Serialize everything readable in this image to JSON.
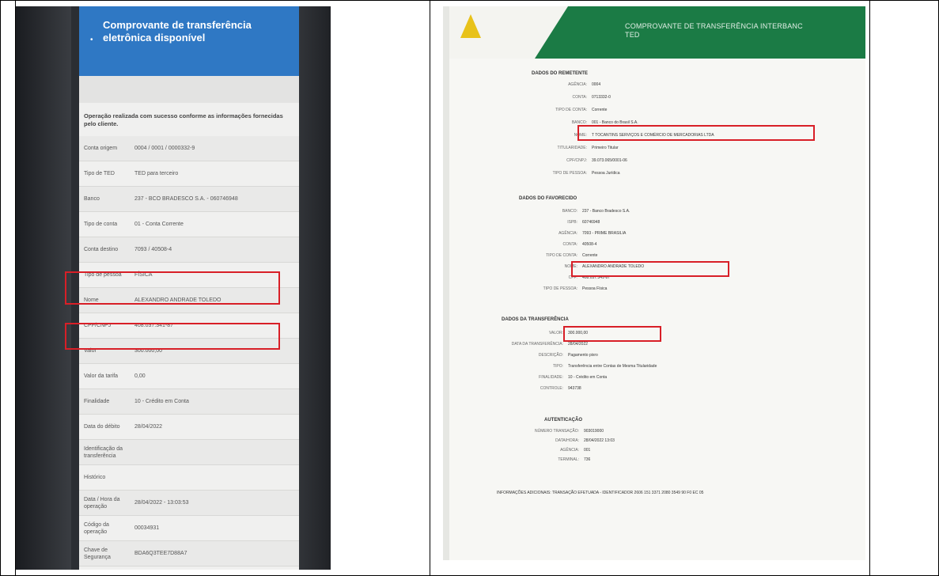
{
  "phone": {
    "header_title": "Comprovante de transferência eletrônica disponível",
    "notice": "Operação realizada com sucesso conforme as informações fornecidas pelo cliente.",
    "rows": [
      {
        "label": "Conta origem",
        "value": "0004 / 0001 / 0000332-9"
      },
      {
        "label": "Tipo de TED",
        "value": "TED para terceiro"
      },
      {
        "label": "Banco",
        "value": "237 - BCO BRADESCO S.A. - 060746948"
      },
      {
        "label": "Tipo de conta",
        "value": "01 - Conta Corrente"
      },
      {
        "label": "Conta destino",
        "value": "7093 / 40508-4"
      },
      {
        "label": "Tipo de pessoa",
        "value": "FÍSICA"
      },
      {
        "label": "Nome",
        "value": "ALEXANDRO ANDRADE TOLEDO"
      },
      {
        "label": "CPF/CNPJ",
        "value": "408.037.341-87"
      },
      {
        "label": "Valor",
        "value": "300.000,00"
      },
      {
        "label": "Valor da tarifa",
        "value": "0,00"
      },
      {
        "label": "Finalidade",
        "value": "10 - Crédito em Conta"
      },
      {
        "label": "Data do débito",
        "value": "28/04/2022"
      },
      {
        "label": "Identificação da transferência",
        "value": ""
      },
      {
        "label": "Histórico",
        "value": ""
      },
      {
        "label": "Data / Hora da operação",
        "value": "28/04/2022 - 13:03:53"
      },
      {
        "label": "Código da operação",
        "value": "00034931"
      },
      {
        "label": "Chave de Segurança",
        "value": "BDA6Q3TEE7D88A7"
      }
    ]
  },
  "receipt": {
    "banner_title": "COMPROVANTE DE TRANSFERÊNCIA INTERBANC",
    "banner_subtitle": "TED",
    "logo_caption": "",
    "sections": {
      "remetente": "DADOS DO REMETENTE",
      "favorecido": "DADOS DO FAVORECIDO",
      "transferencia": "DADOS DA TRANSFERÊNCIA",
      "autenticacao": "AUTENTICAÇÃO"
    },
    "remetente_rows": [
      {
        "k": "AGÊNCIA:",
        "v": "0004"
      },
      {
        "k": "CONTA:",
        "v": "0713332-0"
      },
      {
        "k": "TIPO DE CONTA:",
        "v": "Corrente"
      },
      {
        "k": "BANCO:",
        "v": "001 - Banco do Brasil S.A."
      },
      {
        "k": "NOME:",
        "v": "T TOCANTINS SERVIÇOS E COMÉRCIO DE MERCADORIAS LTDA"
      },
      {
        "k": "TITULARIDADE:",
        "v": "Primeiro Titular"
      },
      {
        "k": "CPF/CNPJ:",
        "v": "39.073.065/0001-06"
      },
      {
        "k": "TIPO DE PESSOA:",
        "v": "Pessoa Jurídica"
      }
    ],
    "favorecido_rows": [
      {
        "k": "BANCO:",
        "v": "237 - Banco Bradesco S.A."
      },
      {
        "k": "ISPB:",
        "v": "60746948"
      },
      {
        "k": "AGÊNCIA:",
        "v": "7093 - PRIME BRASILIA"
      },
      {
        "k": "CONTA:",
        "v": "40508-4"
      },
      {
        "k": "TIPO DE CONTA:",
        "v": "Corrente"
      },
      {
        "k": "NOME:",
        "v": "ALEXANDRO ANDRADE TOLEDO"
      },
      {
        "k": "CPF:",
        "v": "408.037.341-87"
      },
      {
        "k": "TIPO DE PESSOA:",
        "v": "Pessoa Física"
      }
    ],
    "transferencia_rows": [
      {
        "k": "VALOR:",
        "v": "300.000,00"
      },
      {
        "k": "DATA DA TRANSFERÊNCIA:",
        "v": "28/04/2022"
      },
      {
        "k": "DESCRIÇÃO:",
        "v": "Pagamento pixro"
      },
      {
        "k": "TIPO:",
        "v": "Transferência entre Contas de Mesma Titularidade"
      },
      {
        "k": "FINALIDADE:",
        "v": "10 - Crédito em Conta"
      },
      {
        "k": "CONTROLE:",
        "v": "943738"
      }
    ],
    "autenticacao_rows": [
      {
        "k": "NÚMERO TRANSAÇÃO:",
        "v": "903019000"
      },
      {
        "k": "DATA/HORA:",
        "v": "28/04/2022 13:03"
      },
      {
        "k": "AGÊNCIA:",
        "v": "001"
      },
      {
        "k": "TERMINAL:",
        "v": "736"
      }
    ],
    "footer": "INFORMAÇÕES ADICIONAIS: TRANSAÇÃO EFETUADA - IDENTIFICADOR 2606 151 3371 2080 3549 90 F0 EC 05"
  }
}
